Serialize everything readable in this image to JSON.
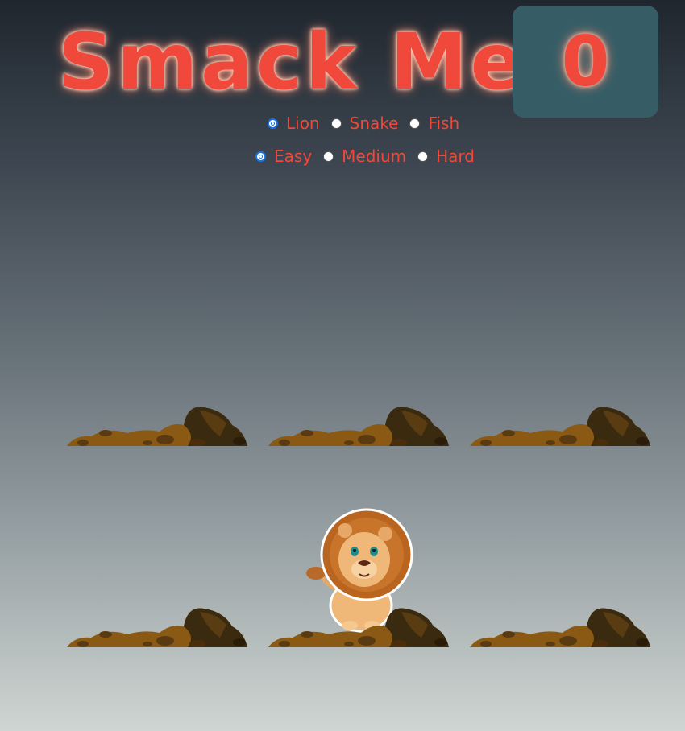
{
  "game": {
    "title": "Smack Me!",
    "score": "0"
  },
  "animal_options": [
    {
      "label": "Lion",
      "selected": true
    },
    {
      "label": "Snake",
      "selected": false
    },
    {
      "label": "Fish",
      "selected": false
    }
  ],
  "difficulty_options": [
    {
      "label": "Easy",
      "selected": true
    },
    {
      "label": "Medium",
      "selected": false
    },
    {
      "label": "Hard",
      "selected": false
    }
  ],
  "board": {
    "hole_count": 6,
    "active_hole": 5,
    "active_animal": "lion-icon"
  },
  "colors": {
    "title": "#f0483a",
    "score_box": "#365d66",
    "dirt": "#7a4f12"
  }
}
